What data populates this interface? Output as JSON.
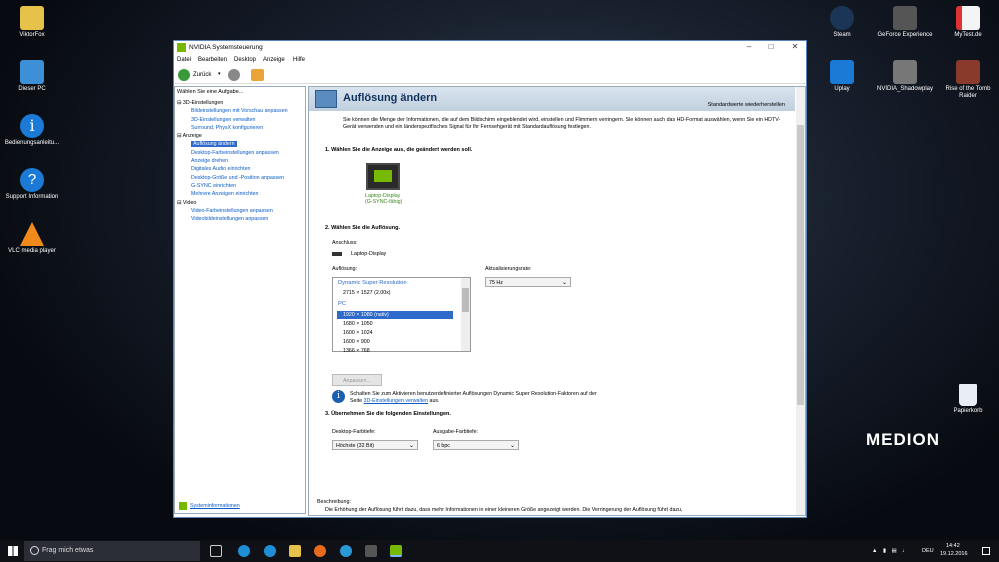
{
  "desktop": {
    "left_icons": [
      {
        "label": "ViktorFox",
        "icon": "folder-icon",
        "color": "#e6c24a"
      },
      {
        "label": "Dieser PC",
        "icon": "computer-icon",
        "color": "#3d8fd6"
      },
      {
        "label": "Bedienungsanleitu...",
        "icon": "info-icon",
        "color": "#1a7ad6"
      },
      {
        "label": "Support Information",
        "icon": "help-icon",
        "color": "#1a7ad6"
      },
      {
        "label": "VLC media player",
        "icon": "vlc-icon",
        "color": "#f08a1a"
      }
    ],
    "right_icons": [
      {
        "label": "Steam",
        "icon": "steam-icon",
        "color": "#1b3556"
      },
      {
        "label": "GeForce Experience",
        "icon": "geforce-icon",
        "color": "#555"
      },
      {
        "label": "MyTest.de",
        "icon": "document-icon",
        "color": "#d33"
      },
      {
        "label": "Uplay",
        "icon": "uplay-icon",
        "color": "#1a7ad6"
      },
      {
        "label": "NVIDIA_Shadowplay",
        "icon": "shadowplay-icon",
        "color": "#777"
      },
      {
        "label": "Rise of the Tomb Raider",
        "icon": "tombraider-icon",
        "color": "#8a3a2a"
      }
    ],
    "recycle_bin": "Papierkorb",
    "brand": "MEDION"
  },
  "taskbar": {
    "search_placeholder": "Frag mich etwas",
    "language": "DEU",
    "time": "14:42",
    "date": "19.12.2016"
  },
  "window": {
    "title": "NVIDIA Systemsteuerung",
    "menu": [
      "Datei",
      "Bearbeiten",
      "Desktop",
      "Anzeige",
      "Hilfe"
    ],
    "back_label": "Zurück",
    "tasks_header": "Wählen Sie eine Aufgabe...",
    "tree": [
      {
        "label": "3D-Einstellungen",
        "level": 0,
        "type": "group"
      },
      {
        "label": "Bildeinstellungen mit Vorschau anpassen",
        "level": 1,
        "type": "link"
      },
      {
        "label": "3D-Einstellungen verwalten",
        "level": 1,
        "type": "link"
      },
      {
        "label": "Surround, PhysX konfigurieren",
        "level": 1,
        "type": "link"
      },
      {
        "label": "Anzeige",
        "level": 0,
        "type": "group"
      },
      {
        "label": "Auflösung ändern",
        "level": 1,
        "type": "selected"
      },
      {
        "label": "Desktop-Farbeinstellungen anpassen",
        "level": 1,
        "type": "link"
      },
      {
        "label": "Anzeige drehen",
        "level": 1,
        "type": "link"
      },
      {
        "label": "Digitales Audio einrichten",
        "level": 1,
        "type": "link"
      },
      {
        "label": "Desktop-Größe und -Position anpassen",
        "level": 1,
        "type": "link"
      },
      {
        "label": "G-SYNC einrichten",
        "level": 1,
        "type": "link"
      },
      {
        "label": "Mehrere Anzeigen einrichten",
        "level": 1,
        "type": "link"
      },
      {
        "label": "Video",
        "level": 0,
        "type": "group"
      },
      {
        "label": "Video-Farbeinstellungen anpassen",
        "level": 1,
        "type": "link"
      },
      {
        "label": "Videobildeinstellungen anpassen",
        "level": 1,
        "type": "link"
      }
    ],
    "system_info": "Systeminformationen"
  },
  "page": {
    "heading": "Auflösung ändern",
    "restore_defaults": "Standardwerte wiederherstellen",
    "intro": "Sie können die Menge der Informationen, die auf dem Bildschirm eingeblendet wird, einstellen und Flimmern verringern. Sie können auch das HD-Format auswählen, wenn Sie ein HDTV-Gerät verwenden und ein länderspezifisches Signal für Ihr Fernsehgerät mit Standardauflösung festlegen.",
    "step1": "1. Wählen Sie die Anzeige aus, die geändert werden soll.",
    "display_name": "Laptop-Display",
    "display_sub": "(G-SYNC-fähig)",
    "step2": "2. Wählen Sie die Auflösung.",
    "connection_label": "Anschluss:",
    "connection_value": "Laptop-Display",
    "resolution_label": "Auflösung:",
    "refresh_label": "Aktualisierungsrate:",
    "refresh_value": "75 Hz",
    "resolutions": {
      "group1": "Dynamic Super Resolution",
      "dsr": "2715 × 1527 (2.00x)",
      "group2": "PC",
      "items": [
        "1920 × 1080 (nativ)",
        "1680 × 1050",
        "1600 × 1024",
        "1600 × 900",
        "1366 × 768"
      ],
      "selected": "1920 × 1080 (nativ)"
    },
    "customize_button": "Anpassen...",
    "dsr_note_1": "Schalten Sie zum Aktivieren benutzerdefinierter Auflösungen Dynamic Super Resolution-Faktoren auf der",
    "dsr_note_2a": "Seite ",
    "dsr_note_link": "3D-Einstellungen verwalten",
    "dsr_note_2b": " aus.",
    "step3": "3. Übernehmen Sie die folgenden Einstellungen.",
    "color_depth_label": "Desktop-Farbtiefe:",
    "color_depth_value": "Höchste (32 Bit)",
    "output_depth_label": "Ausgabe-Farbtiefe:",
    "output_depth_value": "6 bpc",
    "description_label": "Beschreibung:",
    "description_text": "Die Erhöhung der Auflösung führt dazu, dass mehr Informationen in einer kleineren Größe angezeigt werden. Die Verringerung der Auflösung führt dazu,"
  },
  "colors": {
    "nvidia_green": "#76b900",
    "accent": "#2d6ac9",
    "link": "#0b5dc9"
  }
}
